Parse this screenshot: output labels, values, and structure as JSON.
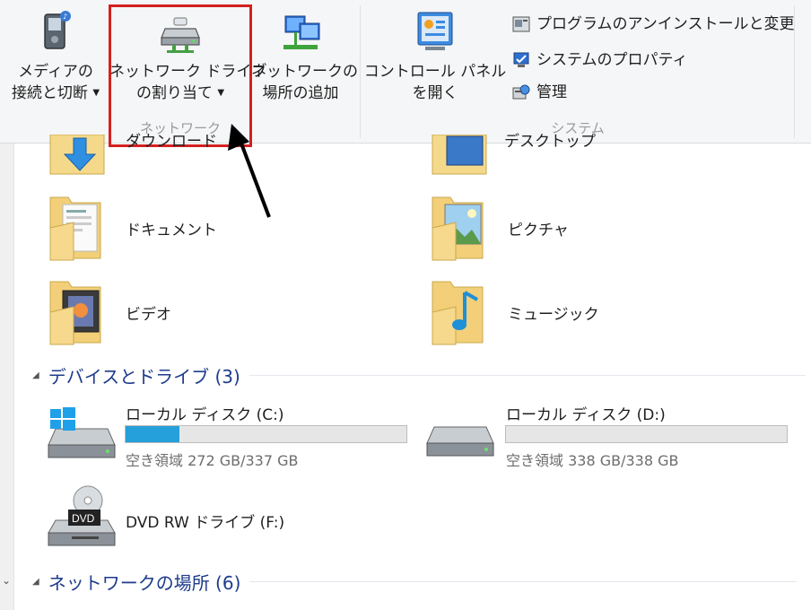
{
  "ribbon": {
    "media_connect": {
      "line1": "メディアの",
      "line2": "接続と切断"
    },
    "map_drive": {
      "line1": "ネットワーク ドライブ",
      "line2": "の割り当て"
    },
    "add_location": {
      "line1": "ネットワークの",
      "line2": "場所の追加"
    },
    "network_group": "ネットワーク",
    "control_panel": {
      "line1": "コントロール パネル",
      "line2": "を開く"
    },
    "system_items": [
      "プログラムのアンインストールと変更",
      "システムのプロパティ",
      "管理"
    ],
    "system_group": "システム"
  },
  "folders": [
    {
      "name": "ダウンロード",
      "icon": "downloads-folder-icon"
    },
    {
      "name": "デスクトップ",
      "icon": "desktop-folder-icon"
    },
    {
      "name": "ドキュメント",
      "icon": "documents-folder-icon"
    },
    {
      "name": "ピクチャ",
      "icon": "pictures-folder-icon"
    },
    {
      "name": "ビデオ",
      "icon": "videos-folder-icon"
    },
    {
      "name": "ミュージック",
      "icon": "music-folder-icon"
    }
  ],
  "devices_section": {
    "title": "デバイスとドライブ (3)"
  },
  "drives": [
    {
      "name": "ローカル ディスク (C:)",
      "free": "空き領域 272 GB/337 GB",
      "used_fraction": 0.193
    },
    {
      "name": "ローカル ディスク (D:)",
      "free": "空き領域 338 GB/338 GB",
      "used_fraction": 0.0
    },
    {
      "name": "DVD RW ドライブ (F:)",
      "badge": "DVD"
    }
  ],
  "network_section": {
    "title": "ネットワークの場所 (6)"
  },
  "colors": {
    "accent": "#26a0da",
    "highlight": "#d42020",
    "section": "#1e3b8c"
  }
}
